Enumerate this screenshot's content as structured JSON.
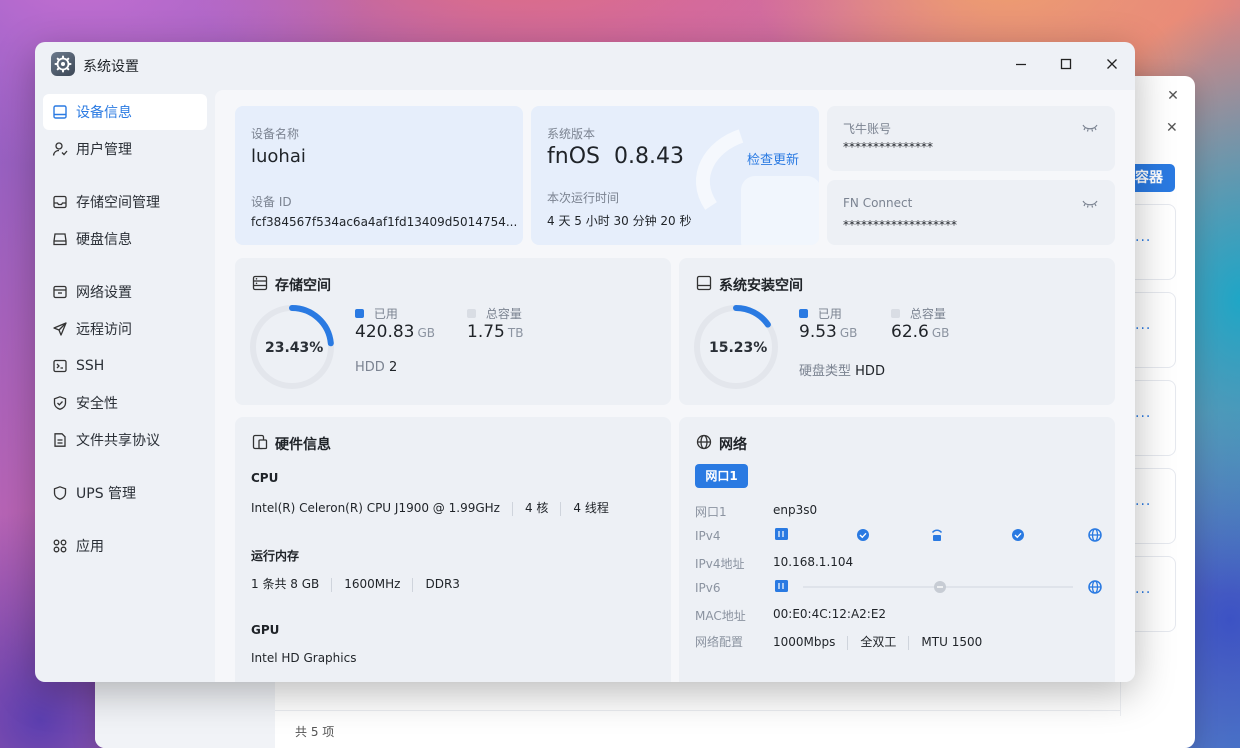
{
  "window": {
    "title": "系统设置"
  },
  "sidebar": {
    "items": [
      {
        "label": "设备信息",
        "icon": "device-icon",
        "active": true
      },
      {
        "label": "用户管理",
        "icon": "user-icon"
      },
      {
        "label": "存储空间管理",
        "icon": "storage-icon"
      },
      {
        "label": "硬盘信息",
        "icon": "disk-icon"
      },
      {
        "label": "网络设置",
        "icon": "network-icon"
      },
      {
        "label": "远程访问",
        "icon": "send-icon"
      },
      {
        "label": "SSH",
        "icon": "terminal-icon"
      },
      {
        "label": "安全性",
        "icon": "shield-icon"
      },
      {
        "label": "文件共享协议",
        "icon": "file-icon"
      },
      {
        "label": "UPS 管理",
        "icon": "ups-icon"
      },
      {
        "label": "应用",
        "icon": "apps-icon"
      }
    ]
  },
  "device": {
    "name_label": "设备名称",
    "name": "luohai",
    "id_label": "设备 ID",
    "id": "fcf384567f534ac6a4af1fd13409d5014754..."
  },
  "system": {
    "version_label": "系统版本",
    "os": "fnOS",
    "version": "0.8.43",
    "check_update": "检查更新",
    "uptime_label": "本次运行时间",
    "uptime": "4 天 5 小时 30 分钟 20 秒"
  },
  "accounts": {
    "feiniu_label": "飞牛账号",
    "feiniu_value": "***************",
    "fnconnect_label": "FN Connect",
    "fnconnect_value": "*******************"
  },
  "storage": {
    "title": "存储空间",
    "percent_text": "23.43%",
    "percent": 23.43,
    "used_label": "已用",
    "used": "420.83",
    "used_unit": "GB",
    "total_label": "总容量",
    "total": "1.75",
    "total_unit": "TB",
    "disk_type": "HDD",
    "disk_count": "2"
  },
  "system_space": {
    "title": "系统安装空间",
    "percent_text": "15.23%",
    "percent": 15.23,
    "used_label": "已用",
    "used": "9.53",
    "used_unit": "GB",
    "total_label": "总容量",
    "total": "62.6",
    "total_unit": "GB",
    "disk_type_label": "硬盘类型",
    "disk_type": "HDD"
  },
  "hardware": {
    "title": "硬件信息",
    "cpu_label": "CPU",
    "cpu_model": "Intel(R) Celeron(R) CPU J1900 @ 1.99GHz",
    "cpu_cores": "4 核",
    "cpu_threads": "4 线程",
    "mem_label": "运行内存",
    "mem_count": "1 条共 8 GB",
    "mem_speed": "1600MHz",
    "mem_type": "DDR3",
    "gpu_label": "GPU",
    "gpu_model": "Intel HD Graphics"
  },
  "network": {
    "title": "网络",
    "port_tab": "网口1",
    "port_label": "网口1",
    "port_value": "enp3s0",
    "ipv4_label": "IPv4",
    "ipv4_addr_label": "IPv4地址",
    "ipv4_addr": "10.168.1.104",
    "ipv6_label": "IPv6",
    "mac_label": "MAC地址",
    "mac": "00:E0:4C:12:A2:E2",
    "config_label": "网络配置",
    "speed": "1000Mbps",
    "duplex": "全双工",
    "mtu": "MTU 1500"
  },
  "background": {
    "add_button": "容器",
    "footer": "共 5 项"
  },
  "colors": {
    "accent": "#2a7ae2",
    "ring_track": "#e3e6ec"
  }
}
